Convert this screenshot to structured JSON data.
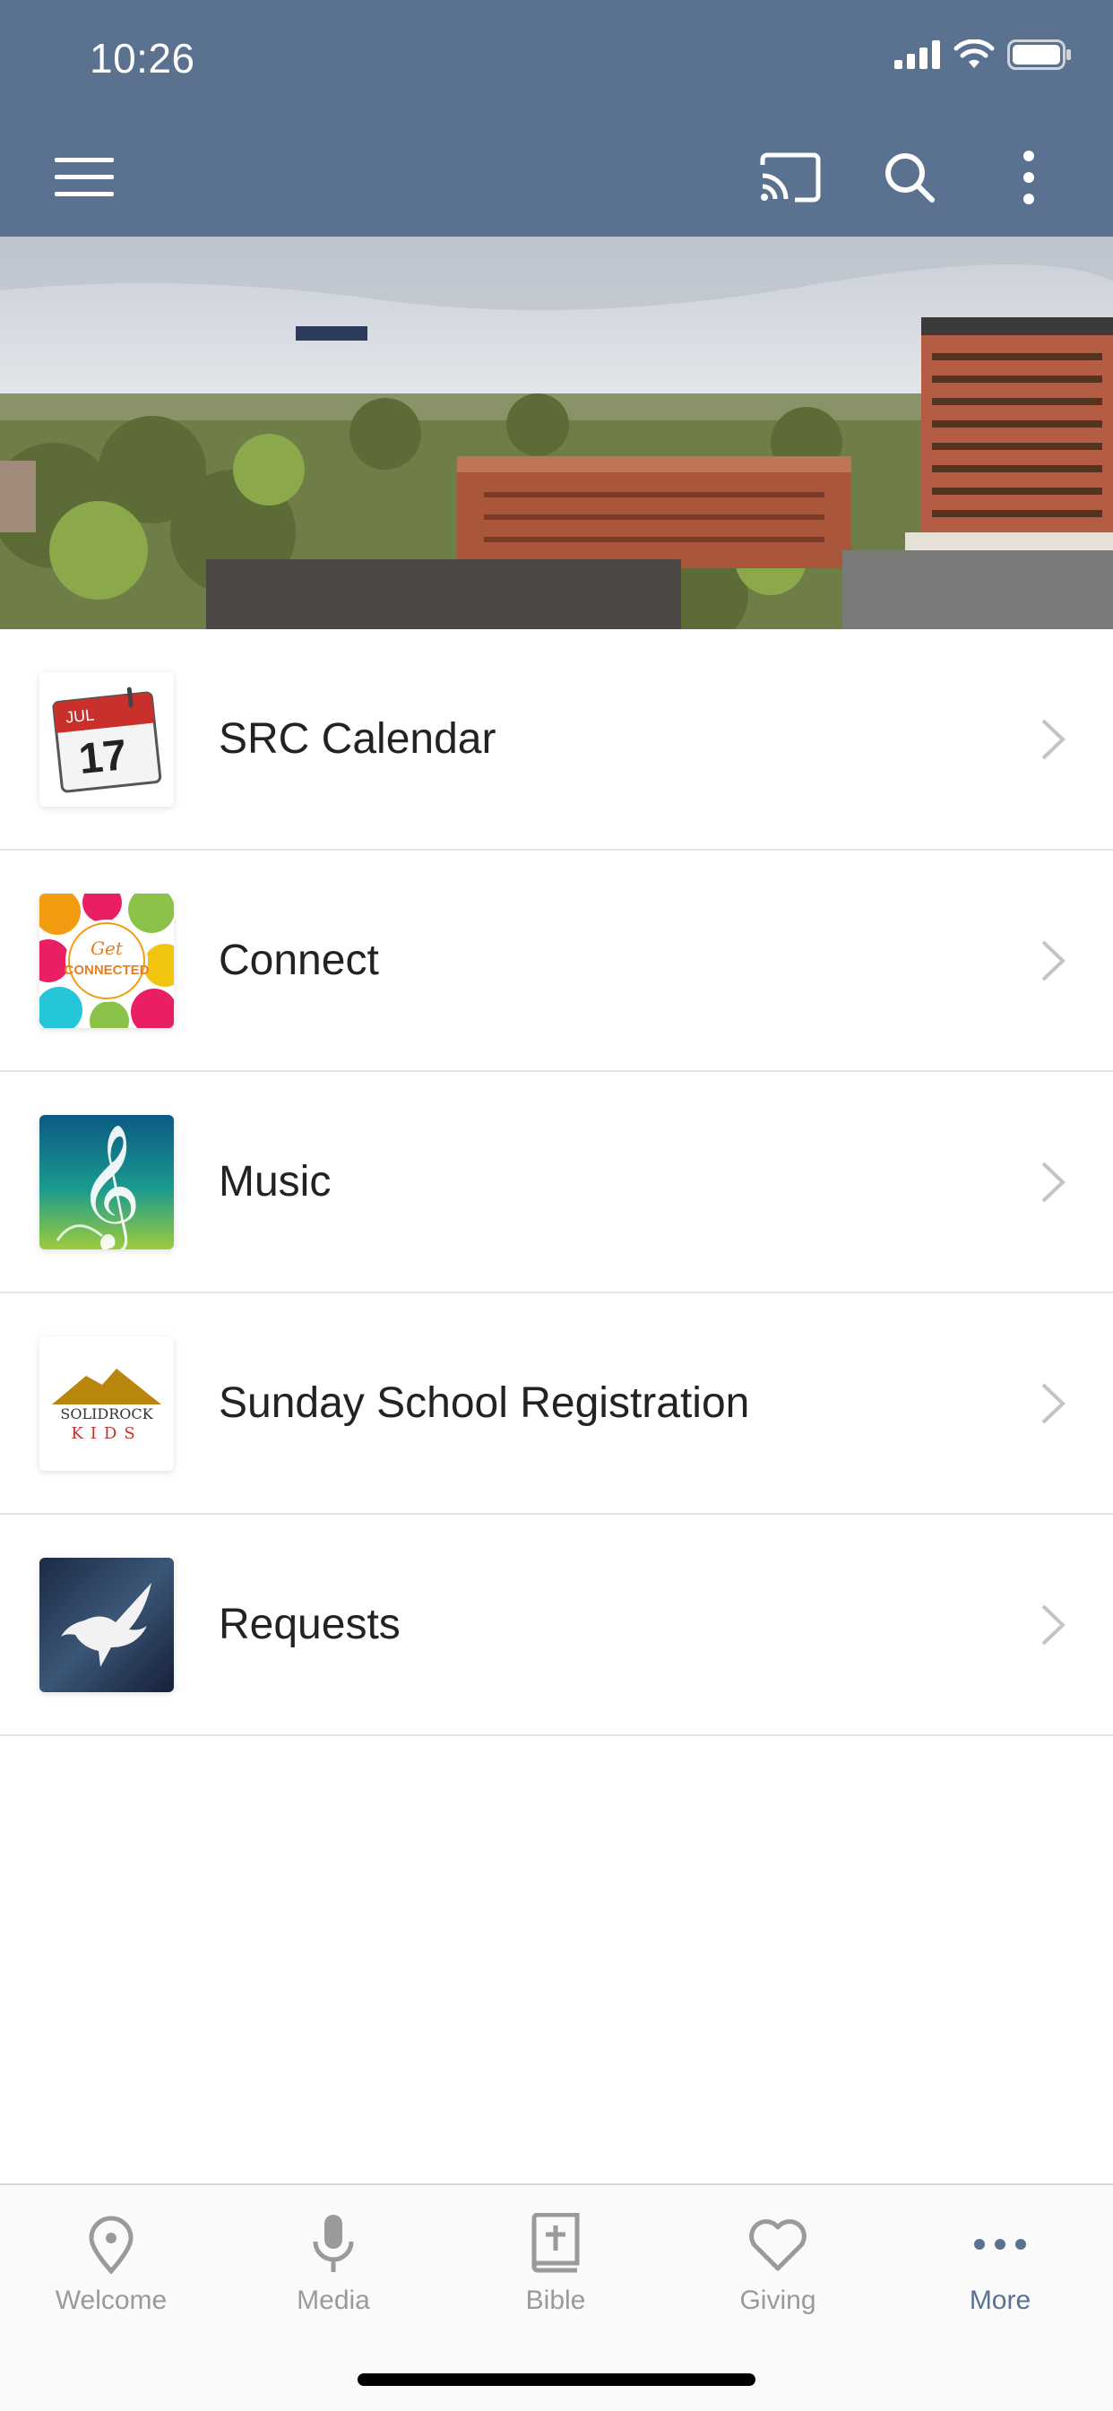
{
  "status_bar": {
    "time": "10:26"
  },
  "list": {
    "items": [
      {
        "label": "SRC Calendar",
        "icon": "calendar-icon"
      },
      {
        "label": "Connect",
        "icon": "get-connected-icon"
      },
      {
        "label": "Music",
        "icon": "treble-clef-icon"
      },
      {
        "label": "Sunday School Registration",
        "icon": "solid-rock-kids-logo"
      },
      {
        "label": "Requests",
        "icon": "dove-icon"
      }
    ]
  },
  "calendar_thumb": {
    "month": "JUL",
    "day": "17"
  },
  "connect_thumb": {
    "line1": "Get",
    "line2": "CONNECTED"
  },
  "kids_thumb": {
    "line1": "SOLIDROCK",
    "line2": "KIDS"
  },
  "tabbar": {
    "tabs": [
      {
        "label": "Welcome",
        "icon": "map-pin-icon"
      },
      {
        "label": "Media",
        "icon": "microphone-icon"
      },
      {
        "label": "Bible",
        "icon": "bible-icon"
      },
      {
        "label": "Giving",
        "icon": "heart-icon"
      },
      {
        "label": "More",
        "icon": "more-dots-icon"
      }
    ],
    "active": "More"
  },
  "colors": {
    "header": "#5a7190",
    "active_tab": "#5a7190",
    "inactive_tab": "#9a9a9a"
  }
}
